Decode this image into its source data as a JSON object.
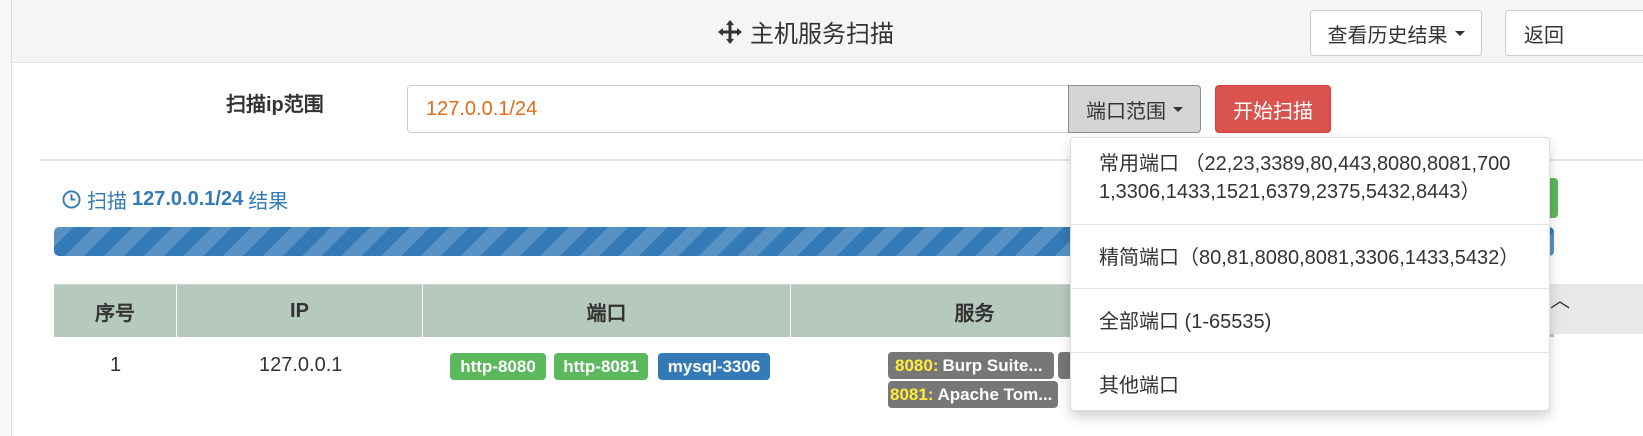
{
  "header": {
    "title": "主机服务扫描",
    "history_button": "查看历史结果",
    "back_button": "返回"
  },
  "scan_form": {
    "label": "扫描ip范围",
    "ip_value": "127.0.0.1/24",
    "port_button": "端口范围",
    "start_button": "开始扫描"
  },
  "result": {
    "prefix": "扫描",
    "target": "127.0.0.1/24",
    "suffix": "结果"
  },
  "table": {
    "columns": [
      "序号",
      "IP",
      "端口",
      "服务"
    ],
    "rows": [
      {
        "index": "1",
        "ip": "127.0.0.1",
        "ports": [
          "http-8080",
          "http-8081",
          "mysql-3306"
        ],
        "services": [
          {
            "port": "8080:",
            "name": "Burp Suite..."
          },
          {
            "port": "8081:",
            "name": "Apache Tom..."
          }
        ]
      }
    ]
  },
  "port_dropdown": {
    "items": [
      {
        "line1": "常用端口 （22,23,3389,80,443,8080,8081,700",
        "line2": "1,3306,1433,1521,6379,2375,5432,8443）"
      },
      {
        "line1": "精简端口（80,81,8080,8081,3306,1433,5432）"
      },
      {
        "line1": "全部端口 (1-65535)"
      },
      {
        "line1": "其他端口"
      }
    ]
  },
  "colors": {
    "primary": "#337ab7",
    "success": "#5cb85c",
    "danger": "#d9534f",
    "table_header": "#b5c9bd",
    "input_text": "#e06c1a"
  }
}
